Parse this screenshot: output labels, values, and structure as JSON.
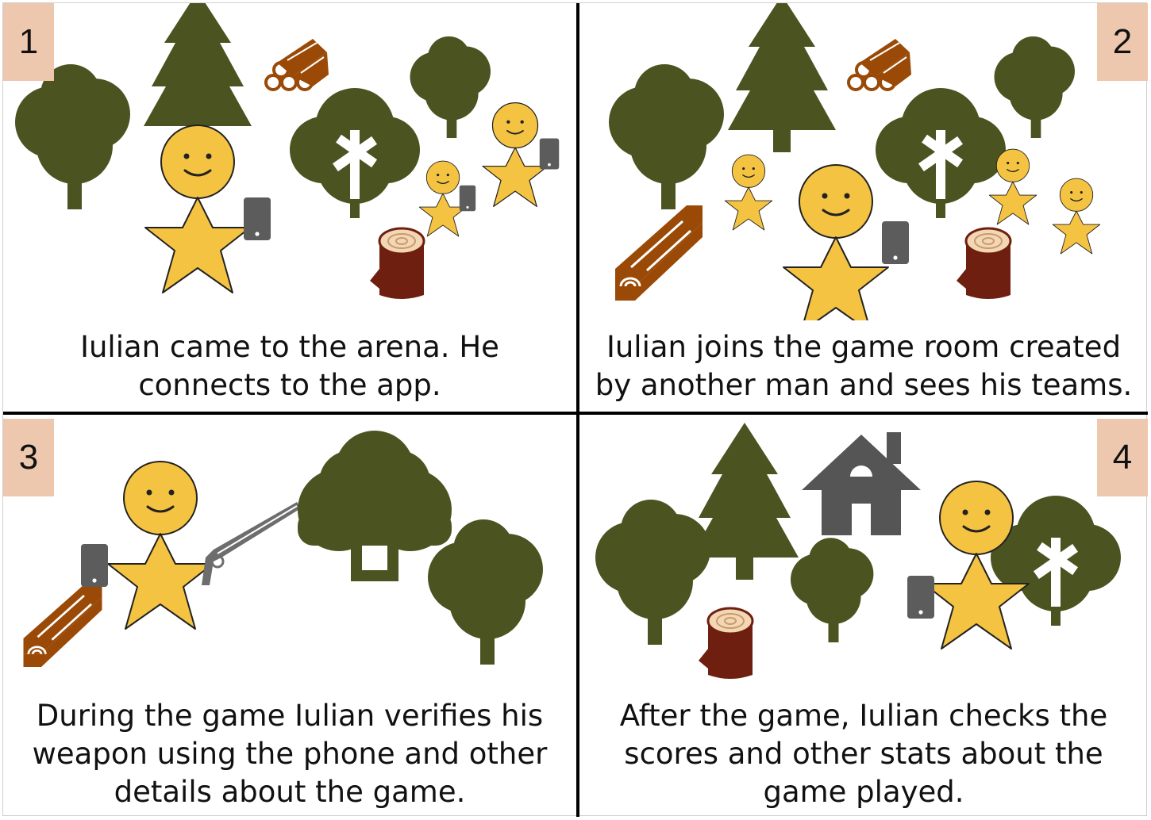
{
  "panels": [
    {
      "number": "1",
      "caption": "Iulian came to the arena. He\nconnects to the app."
    },
    {
      "number": "2",
      "caption": "Iulian joins the game room created\nby another man and sees his teams."
    },
    {
      "number": "3",
      "caption": "During the game Iulian verifies his\nweapon using the phone and other\ndetails about the game."
    },
    {
      "number": "4",
      "caption": "After the game, Iulian checks the\nscores and other stats about the\ngame played."
    }
  ],
  "colors": {
    "tree": "#4b5320",
    "person": "#f5c342",
    "phone": "#5c5c5c",
    "wood": "#9a4a06",
    "stump": "#6e1f10",
    "stump_top": "#f3d7b5",
    "badge": "#edc7ae",
    "house": "#555555"
  }
}
